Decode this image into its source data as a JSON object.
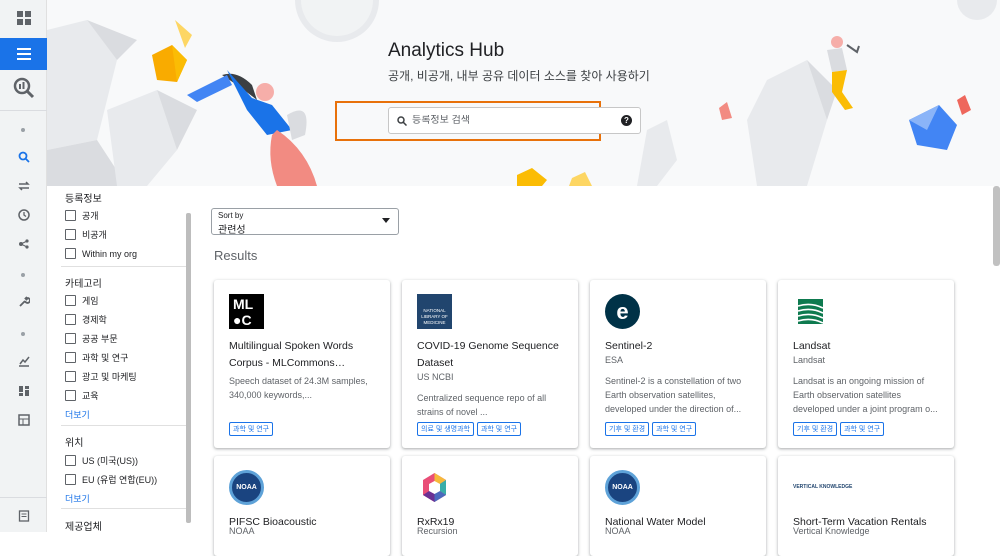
{
  "hero": {
    "title": "Analytics Hub",
    "subtitle": "공개, 비공개, 내부 공유 데이터 소스를 찾아 사용하기",
    "search_placeholder": "등록정보 검색",
    "help": "?"
  },
  "filters": {
    "listing": {
      "label": "등록정보",
      "items": [
        "공개",
        "비공개",
        "Within my org"
      ]
    },
    "category": {
      "label": "카테고리",
      "items": [
        "게임",
        "경제학",
        "공공 부문",
        "과학 및 연구",
        "광고 및 마케팅",
        "교육"
      ],
      "more": "더보기"
    },
    "location": {
      "label": "위치",
      "items": [
        "US (미국(US))",
        "EU (유럽 연합(EU))"
      ],
      "more": "더보기"
    },
    "provider": {
      "label": "제공업체"
    }
  },
  "sort": {
    "label": "Sort by",
    "value": "관련성"
  },
  "results_label": "Results",
  "cards": [
    {
      "title": "Multilingual Spoken Words Corpus - MLCommons…",
      "provider": "",
      "description": "Speech dataset of 24.3M samples, 340,000 keywords,...",
      "tags": [
        "과학 및 연구"
      ],
      "logo": "mlc-logo",
      "logo_text": [
        "ML",
        "●C"
      ]
    },
    {
      "title": "COVID-19 Genome Sequence Dataset",
      "provider": "US NCBI",
      "description": "Centralized sequence repo of all strains of novel ...",
      "tags": [
        "의료 및 생명과학",
        "과학 및 연구"
      ],
      "logo": "nlm-logo",
      "logo_text": [
        "NATIONAL",
        "LIBRARY OF",
        "MEDICINE"
      ]
    },
    {
      "title": "Sentinel-2",
      "provider": "ESA",
      "description": "Sentinel-2 is a constellation of two Earth observation satellites, developed under the direction of...",
      "tags": [
        "기후 및 환경",
        "과학 및 연구"
      ],
      "logo": "esa-logo",
      "logo_text": [
        "e"
      ]
    },
    {
      "title": "Landsat",
      "provider": "Landsat",
      "description": "Landsat is an ongoing mission of Earth observation satellites developed under a joint program o...",
      "tags": [
        "기후 및 환경",
        "과학 및 연구"
      ],
      "logo": "landsat-logo",
      "logo_text": []
    },
    {
      "title": "PIFSC Bioacoustic",
      "provider": "NOAA",
      "logo": "noaa-logo",
      "logo_text": [
        "NOAA"
      ]
    },
    {
      "title": "RxRx19",
      "provider": "Recursion",
      "logo": "recursion-logo",
      "logo_text": []
    },
    {
      "title": "National Water Model",
      "provider": "NOAA",
      "logo": "noaa-logo",
      "logo_text": [
        "NOAA"
      ]
    },
    {
      "title": "Short-Term Vacation Rentals",
      "provider": "Vertical Knowledge",
      "logo": "vk-logo",
      "logo_text": [
        "VERTICAL KNOWLEDGE"
      ]
    }
  ],
  "colors": {
    "accent": "#1a73e8",
    "highlight": "#e8710a"
  }
}
